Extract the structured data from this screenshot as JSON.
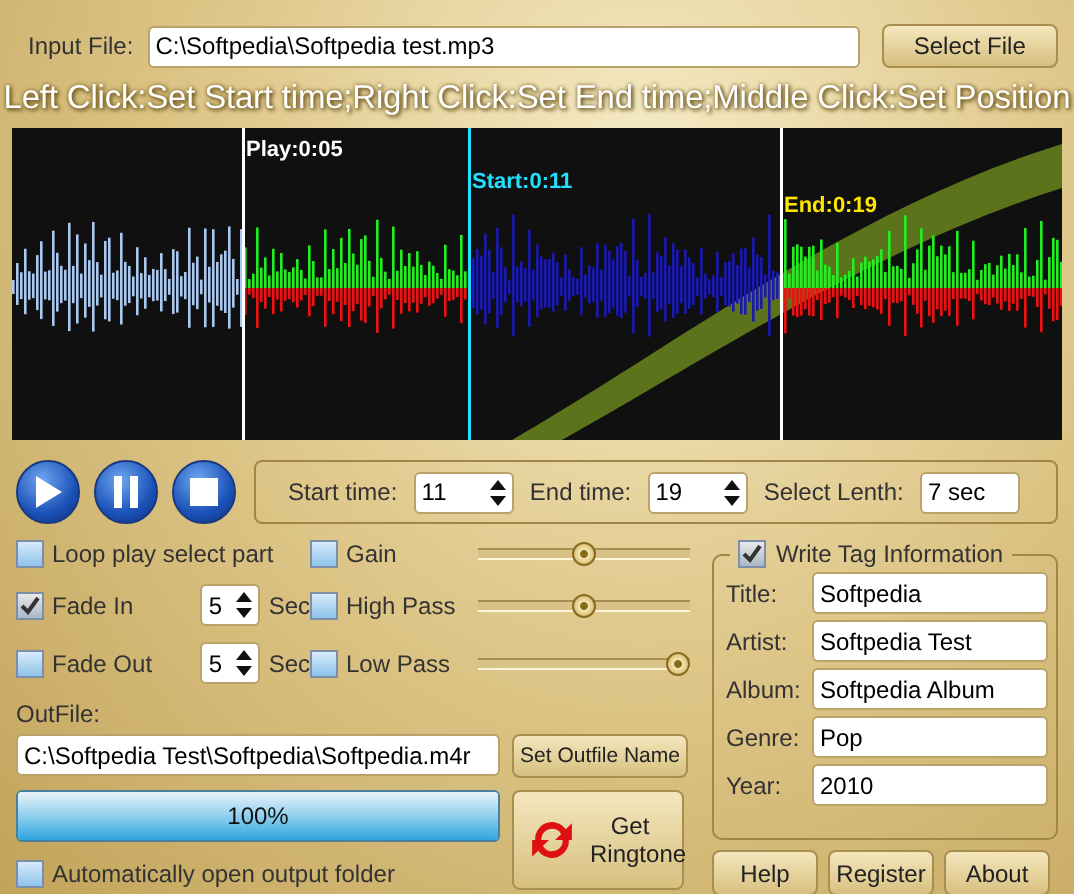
{
  "input_file": {
    "label": "Input File:",
    "value": "C:\\Softpedia\\Softpedia test.mp3"
  },
  "select_file_button": "Select File",
  "hint": "Left Click:Set Start time;Right Click:Set End time;Middle Click:Set Position",
  "markers": [
    {
      "kind": "play",
      "label": "Play:0:05"
    },
    {
      "kind": "start",
      "label": "Start:0:11"
    },
    {
      "kind": "end",
      "label": "End:0:19"
    }
  ],
  "times": [
    {
      "label": "Start time:",
      "value": "11",
      "kind": "spin"
    },
    {
      "label": "End time:",
      "value": "19",
      "kind": "spin"
    },
    {
      "label": "Select Lenth:",
      "value": "7 sec",
      "kind": "text"
    }
  ],
  "options": [
    {
      "label": "Loop play select part",
      "checked": false
    },
    {
      "label": "Fade In",
      "checked": true,
      "seconds": "5",
      "unit": "Sec"
    },
    {
      "label": "Fade Out",
      "checked": false,
      "seconds": "5",
      "unit": "Sec"
    }
  ],
  "effects": [
    {
      "label": "Gain",
      "checked": false,
      "level": 0.5
    },
    {
      "label": "High Pass",
      "checked": false,
      "level": 0.5
    },
    {
      "label": "Low Pass",
      "checked": false,
      "level": 1
    }
  ],
  "outfile": {
    "label": "OutFile:",
    "value": "C:\\Softpedia Test\\Softpedia\\Softpedia.m4r",
    "button": "Set Outfile Name"
  },
  "progress": {
    "level": 1,
    "text": "100%"
  },
  "auto_open": {
    "label": "Automatically open output folder",
    "checked": false
  },
  "ringtone_button": "Get Ringtone",
  "tag": {
    "label": "Write Tag Information",
    "checked": true,
    "fields": [
      {
        "label": "Title:",
        "value": "Softpedia"
      },
      {
        "label": "Artist:",
        "value": "Softpedia Test"
      },
      {
        "label": "Album:",
        "value": "Softpedia Album"
      },
      {
        "label": "Genre:",
        "value": "Pop"
      },
      {
        "label": "Year:",
        "value": "2010"
      }
    ]
  },
  "buttons": [
    "Help",
    "Register",
    "About"
  ]
}
